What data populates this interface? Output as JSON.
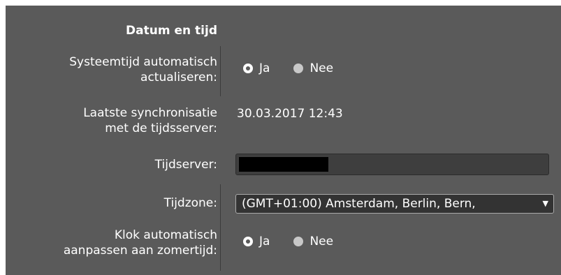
{
  "section": {
    "title": "Datum en tijd"
  },
  "auto_update": {
    "label_line1": "Systeemtijd automatisch",
    "label_line2": "actualiseren:",
    "options": [
      {
        "label": "Ja",
        "selected": true
      },
      {
        "label": "Nee",
        "selected": false
      }
    ]
  },
  "last_sync": {
    "label_line1": "Laatste synchronisatie",
    "label_line2": "met de tijdsserver:",
    "value": "30.03.2017 12:43"
  },
  "time_server": {
    "label": "Tijdserver:",
    "value_redacted": true
  },
  "timezone": {
    "label": "Tijdzone:",
    "selected": "(GMT+01:00) Amsterdam, Berlin, Bern,",
    "arrow": "▼"
  },
  "dst": {
    "label_line1": "Klok automatisch",
    "label_line2": "aanpassen aan zomertijd:",
    "options": [
      {
        "label": "Ja",
        "selected": true
      },
      {
        "label": "Nee",
        "selected": false
      }
    ]
  },
  "colors": {
    "panel_bg": "#5a5a5a",
    "text": "#ffffff",
    "input_bg": "#3e3e3e",
    "select_bg": "#333333"
  }
}
